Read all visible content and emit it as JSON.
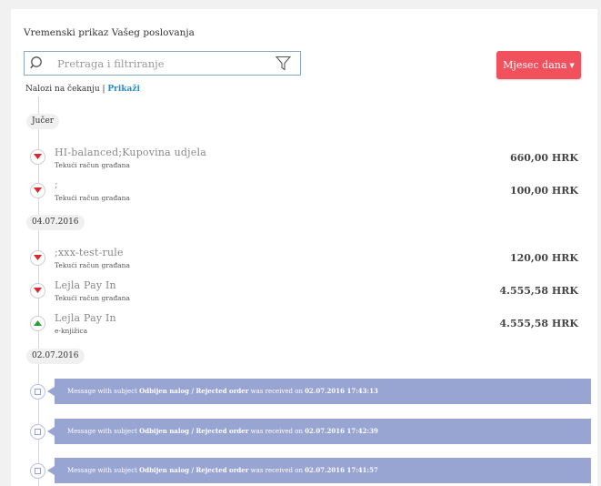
{
  "title": "Vremenski prikaz Vašeg poslovanja",
  "search": {
    "placeholder": "Pretraga i filtriranje"
  },
  "period_button": "Mjesec dana",
  "pending": {
    "label": "Nalozi na čekanju | ",
    "link": "Prikaži"
  },
  "groups": [
    {
      "date": "Jučer"
    },
    {
      "date": "04.07.2016"
    },
    {
      "date": "02.07.2016"
    }
  ],
  "transactions": [
    {
      "name": "HI-balanced;Kupovina udjela",
      "account": "Tekući račun građana",
      "amount": "660,00 HRK",
      "direction": "out"
    },
    {
      "name": ";",
      "account": "Tekući račun građana",
      "amount": "100,00 HRK",
      "direction": "out"
    },
    {
      "name": ";xxx-test-rule",
      "account": "Tekući račun građana",
      "amount": "120,00 HRK",
      "direction": "out"
    },
    {
      "name": "Lejla Pay In",
      "account": "Tekući račun građana",
      "amount": "4.555,58 HRK",
      "direction": "out"
    },
    {
      "name": "Lejla Pay In",
      "account": "e-knjižica",
      "amount": "4.555,58 HRK",
      "direction": "in"
    }
  ],
  "messages": [
    {
      "prefix": "Message with subject ",
      "subject": "Odbijen nalog / Rejected order",
      "mid": " was received on ",
      "timestamp": "02.07.2016 17:43:13"
    },
    {
      "prefix": "Message with subject ",
      "subject": "Odbijen nalog / Rejected order",
      "mid": " was received on ",
      "timestamp": "02.07.2016 17:42:39"
    },
    {
      "prefix": "Message with subject ",
      "subject": "Odbijen nalog / Rejected order",
      "mid": " was received on ",
      "timestamp": "02.07.2016 17:41:57"
    }
  ],
  "colors": {
    "accent_red": "#f0515d",
    "link_blue": "#2a8bcf",
    "message_bar": "#98a4d2",
    "out_arrow": "#e0262b",
    "in_arrow": "#2e9e3a"
  },
  "icons": {
    "search": "search-icon",
    "filter": "filter-icon",
    "out": "arrow-down-icon",
    "in": "arrow-up-icon",
    "message": "envelope-icon"
  }
}
